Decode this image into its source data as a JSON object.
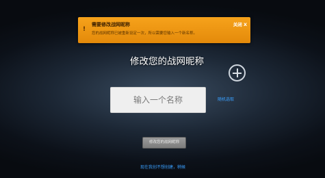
{
  "notification": {
    "icon": "warning-icon",
    "title": "需要修改战网昵称",
    "body": "您的战网昵称已被重新设定一次，所以需要您输入一个新名称。",
    "close_label": "关闭 X"
  },
  "page_title": "修改您的战网昵称",
  "add_avatar_icon": "plus-circle-icon",
  "name_input": {
    "placeholder": "输入一个名称",
    "value": ""
  },
  "random_link": "随机选取",
  "submit_label": "修改您的战网昵称",
  "skip_link": "现在我创不想创建，稍候",
  "colors": {
    "notification_bg": "#f39c12",
    "link": "#3aa0ff",
    "button_bg": "#8a8a8a"
  }
}
